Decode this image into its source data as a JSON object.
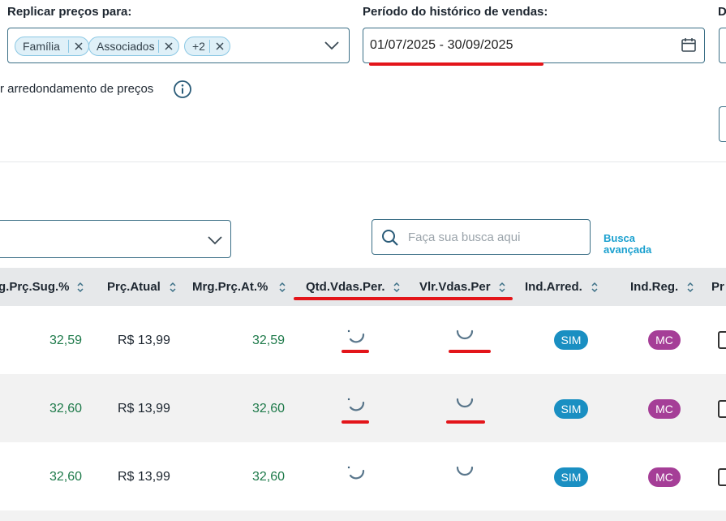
{
  "filters": {
    "replicate_label": "Replicar preços para:",
    "replicate_chips": [
      "Família",
      "Associados",
      "+2"
    ],
    "period_label": "Período do histórico de vendas:",
    "period_value": "01/07/2025 - 30/09/2025",
    "third_label_partial": "D",
    "rounding_label": "r arredondamento de preços"
  },
  "search": {
    "placeholder": "Faça sua busca aqui",
    "advanced_line1": "Busca",
    "advanced_line2": "avançada"
  },
  "table": {
    "headers": [
      "g.Prç.Sug.%",
      "Prç.Atual",
      "Mrg.Prç.At.%",
      "Qtd.Vdas.Per.",
      "Vlr.Vdas.Per",
      "Ind.Arred.",
      "Ind.Reg.",
      "Pr"
    ],
    "rows": [
      {
        "mrg_sug": "32,59",
        "prc_atual": "R$ 13,99",
        "mrg_atual": "32,59",
        "ind_arred": "SIM",
        "ind_reg": "MC"
      },
      {
        "mrg_sug": "32,60",
        "prc_atual": "R$ 13,99",
        "mrg_atual": "32,60",
        "ind_arred": "SIM",
        "ind_reg": "MC"
      },
      {
        "mrg_sug": "32,60",
        "prc_atual": "R$ 13,99",
        "mrg_atual": "32,60",
        "ind_arred": "SIM",
        "ind_reg": "MC"
      }
    ]
  },
  "colors": {
    "accent": "#1aa0cf",
    "highlight_red": "#e3151a",
    "positive_green": "#1e7a4a",
    "badge_sim": "#1a8fc2",
    "badge_mc": "#a53e97"
  },
  "icons": [
    "close-icon",
    "chevron-down-icon",
    "calendar-icon",
    "info-icon",
    "search-icon",
    "sort-icon",
    "loading-spinner-icon"
  ]
}
